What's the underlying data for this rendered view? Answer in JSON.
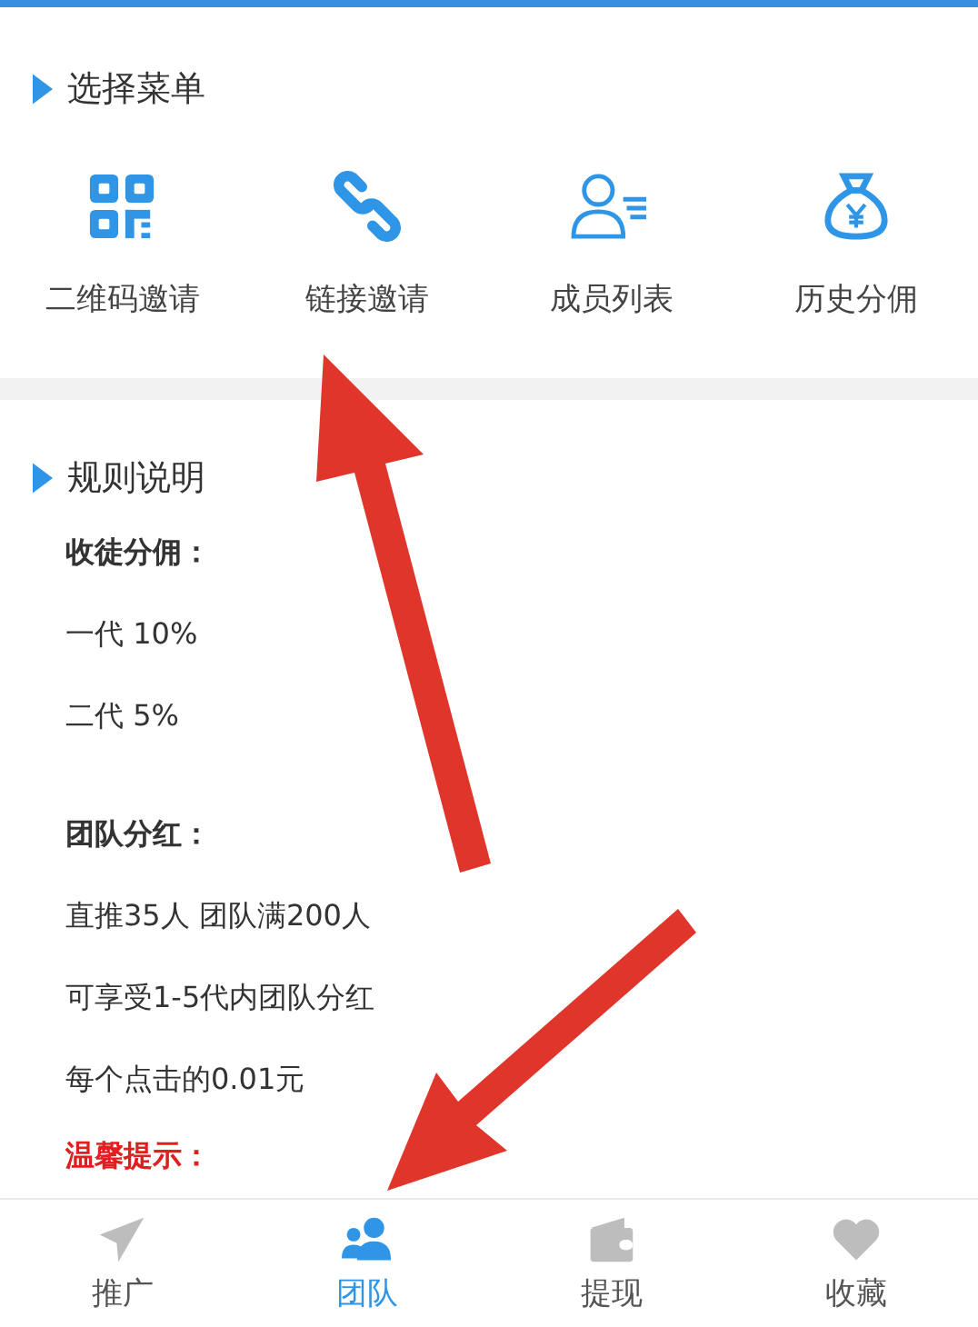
{
  "menu_section": {
    "title": "选择菜单"
  },
  "menu_items": [
    {
      "label": "二维码邀请",
      "kind": "qr"
    },
    {
      "label": "链接邀请",
      "kind": "link"
    },
    {
      "label": "成员列表",
      "kind": "members"
    },
    {
      "label": "历史分佣",
      "kind": "moneybag"
    }
  ],
  "rules_section": {
    "title": "规则说明"
  },
  "rules": [
    {
      "text": "收徒分佣：",
      "kind": "heading"
    },
    {
      "text": "一代 10%",
      "kind": "text"
    },
    {
      "text": "二代 5%",
      "kind": "text"
    },
    {
      "text": "团队分红：",
      "kind": "heading"
    },
    {
      "text": "直推35人 团队满200人",
      "kind": "text"
    },
    {
      "text": "可享受1-5代内团队分红",
      "kind": "text"
    },
    {
      "text": "每个点击的0.01元",
      "kind": "text"
    },
    {
      "text": "温馨提示：",
      "kind": "warning"
    }
  ],
  "tab_bar": [
    {
      "label": "推广",
      "kind": "send",
      "selected": false
    },
    {
      "label": "团队",
      "kind": "team",
      "selected": true
    },
    {
      "label": "提现",
      "kind": "wallet",
      "selected": false
    },
    {
      "label": "收藏",
      "kind": "heart",
      "selected": false
    }
  ]
}
